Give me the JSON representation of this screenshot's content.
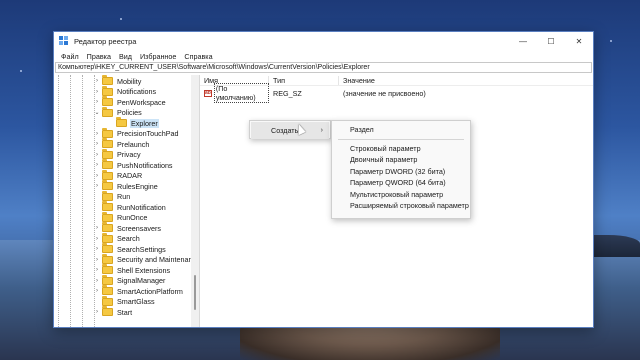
{
  "window": {
    "title": "Редактор реестра",
    "controls": {
      "minimize": "—",
      "maximize": "☐",
      "close": "✕"
    }
  },
  "menu": [
    "Файл",
    "Правка",
    "Вид",
    "Избранное",
    "Справка"
  ],
  "address": "Компьютер\\HKEY_CURRENT_USER\\Software\\Microsoft\\Windows\\CurrentVersion\\Policies\\Explorer",
  "tree": [
    {
      "label": "Mobility",
      "chevron": "›"
    },
    {
      "label": "Notifications",
      "chevron": "›"
    },
    {
      "label": "PenWorkspace",
      "chevron": "›"
    },
    {
      "label": "Policies",
      "chevron": "⌄"
    },
    {
      "label": "Explorer",
      "chevron": "",
      "selected": true
    },
    {
      "label": "PrecisionTouchPad",
      "chevron": "›"
    },
    {
      "label": "Prelaunch",
      "chevron": "›"
    },
    {
      "label": "Privacy",
      "chevron": "›"
    },
    {
      "label": "PushNotifications",
      "chevron": "›"
    },
    {
      "label": "RADAR",
      "chevron": "›"
    },
    {
      "label": "RulesEngine",
      "chevron": "›"
    },
    {
      "label": "Run",
      "chevron": ""
    },
    {
      "label": "RunNotification",
      "chevron": ""
    },
    {
      "label": "RunOnce",
      "chevron": ""
    },
    {
      "label": "Screensavers",
      "chevron": "›"
    },
    {
      "label": "Search",
      "chevron": "›"
    },
    {
      "label": "SearchSettings",
      "chevron": "›"
    },
    {
      "label": "Security and Maintenanc",
      "chevron": "›"
    },
    {
      "label": "Shell Extensions",
      "chevron": "›"
    },
    {
      "label": "SignalManager",
      "chevron": "›"
    },
    {
      "label": "SmartActionPlatform",
      "chevron": "›"
    },
    {
      "label": "SmartGlass",
      "chevron": ""
    },
    {
      "label": "Start",
      "chevron": "›"
    }
  ],
  "list": {
    "headers": {
      "name": "Имя",
      "type": "Тип",
      "value": "Значение"
    },
    "rows": [
      {
        "icon": "ab",
        "name": "(По умолчанию)",
        "type": "REG_SZ",
        "value": "(значение не присвоено)"
      }
    ]
  },
  "context_menu": {
    "create": "Создать",
    "submenu_arrow": "›",
    "submenu": {
      "key": "Раздел",
      "items": [
        "Строковый параметр",
        "Двоичный параметр",
        "Параметр DWORD (32 бита)",
        "Параметр QWORD (64 бита)",
        "Мультистроковый параметр",
        "Расширяемый строковый параметр"
      ]
    }
  }
}
